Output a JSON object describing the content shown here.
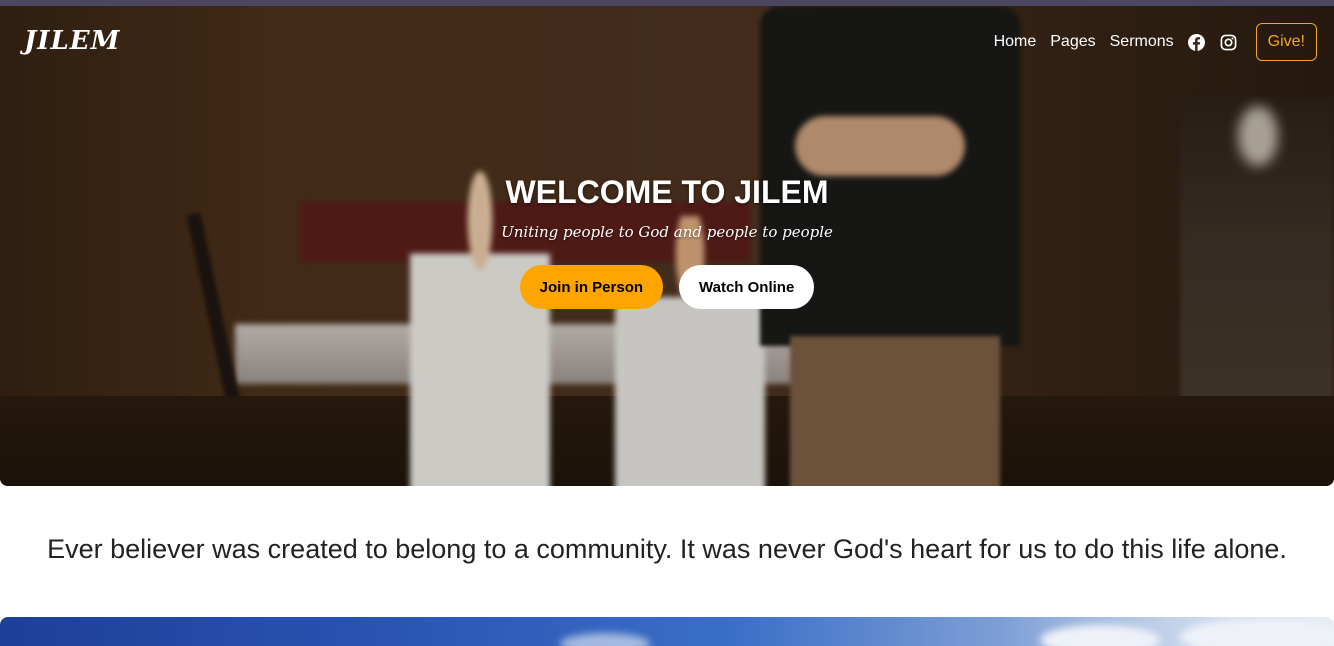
{
  "nav": {
    "logo": "JILEM",
    "links": [
      "Home",
      "Pages",
      "Sermons"
    ],
    "icons": [
      "facebook-icon",
      "instagram-icon"
    ],
    "give_label": "Give!"
  },
  "hero": {
    "title": "WELCOME TO JILEM",
    "subtitle": "Uniting people to God and people to people",
    "primary_button": "Join in Person",
    "secondary_button": "Watch Online"
  },
  "tagline": "Ever believer was created to belong to a community. It was never God's heart for us to do this life alone.",
  "colors": {
    "accent": "#ffa500",
    "give_border": "#f5a623",
    "text_dark": "#222222"
  }
}
